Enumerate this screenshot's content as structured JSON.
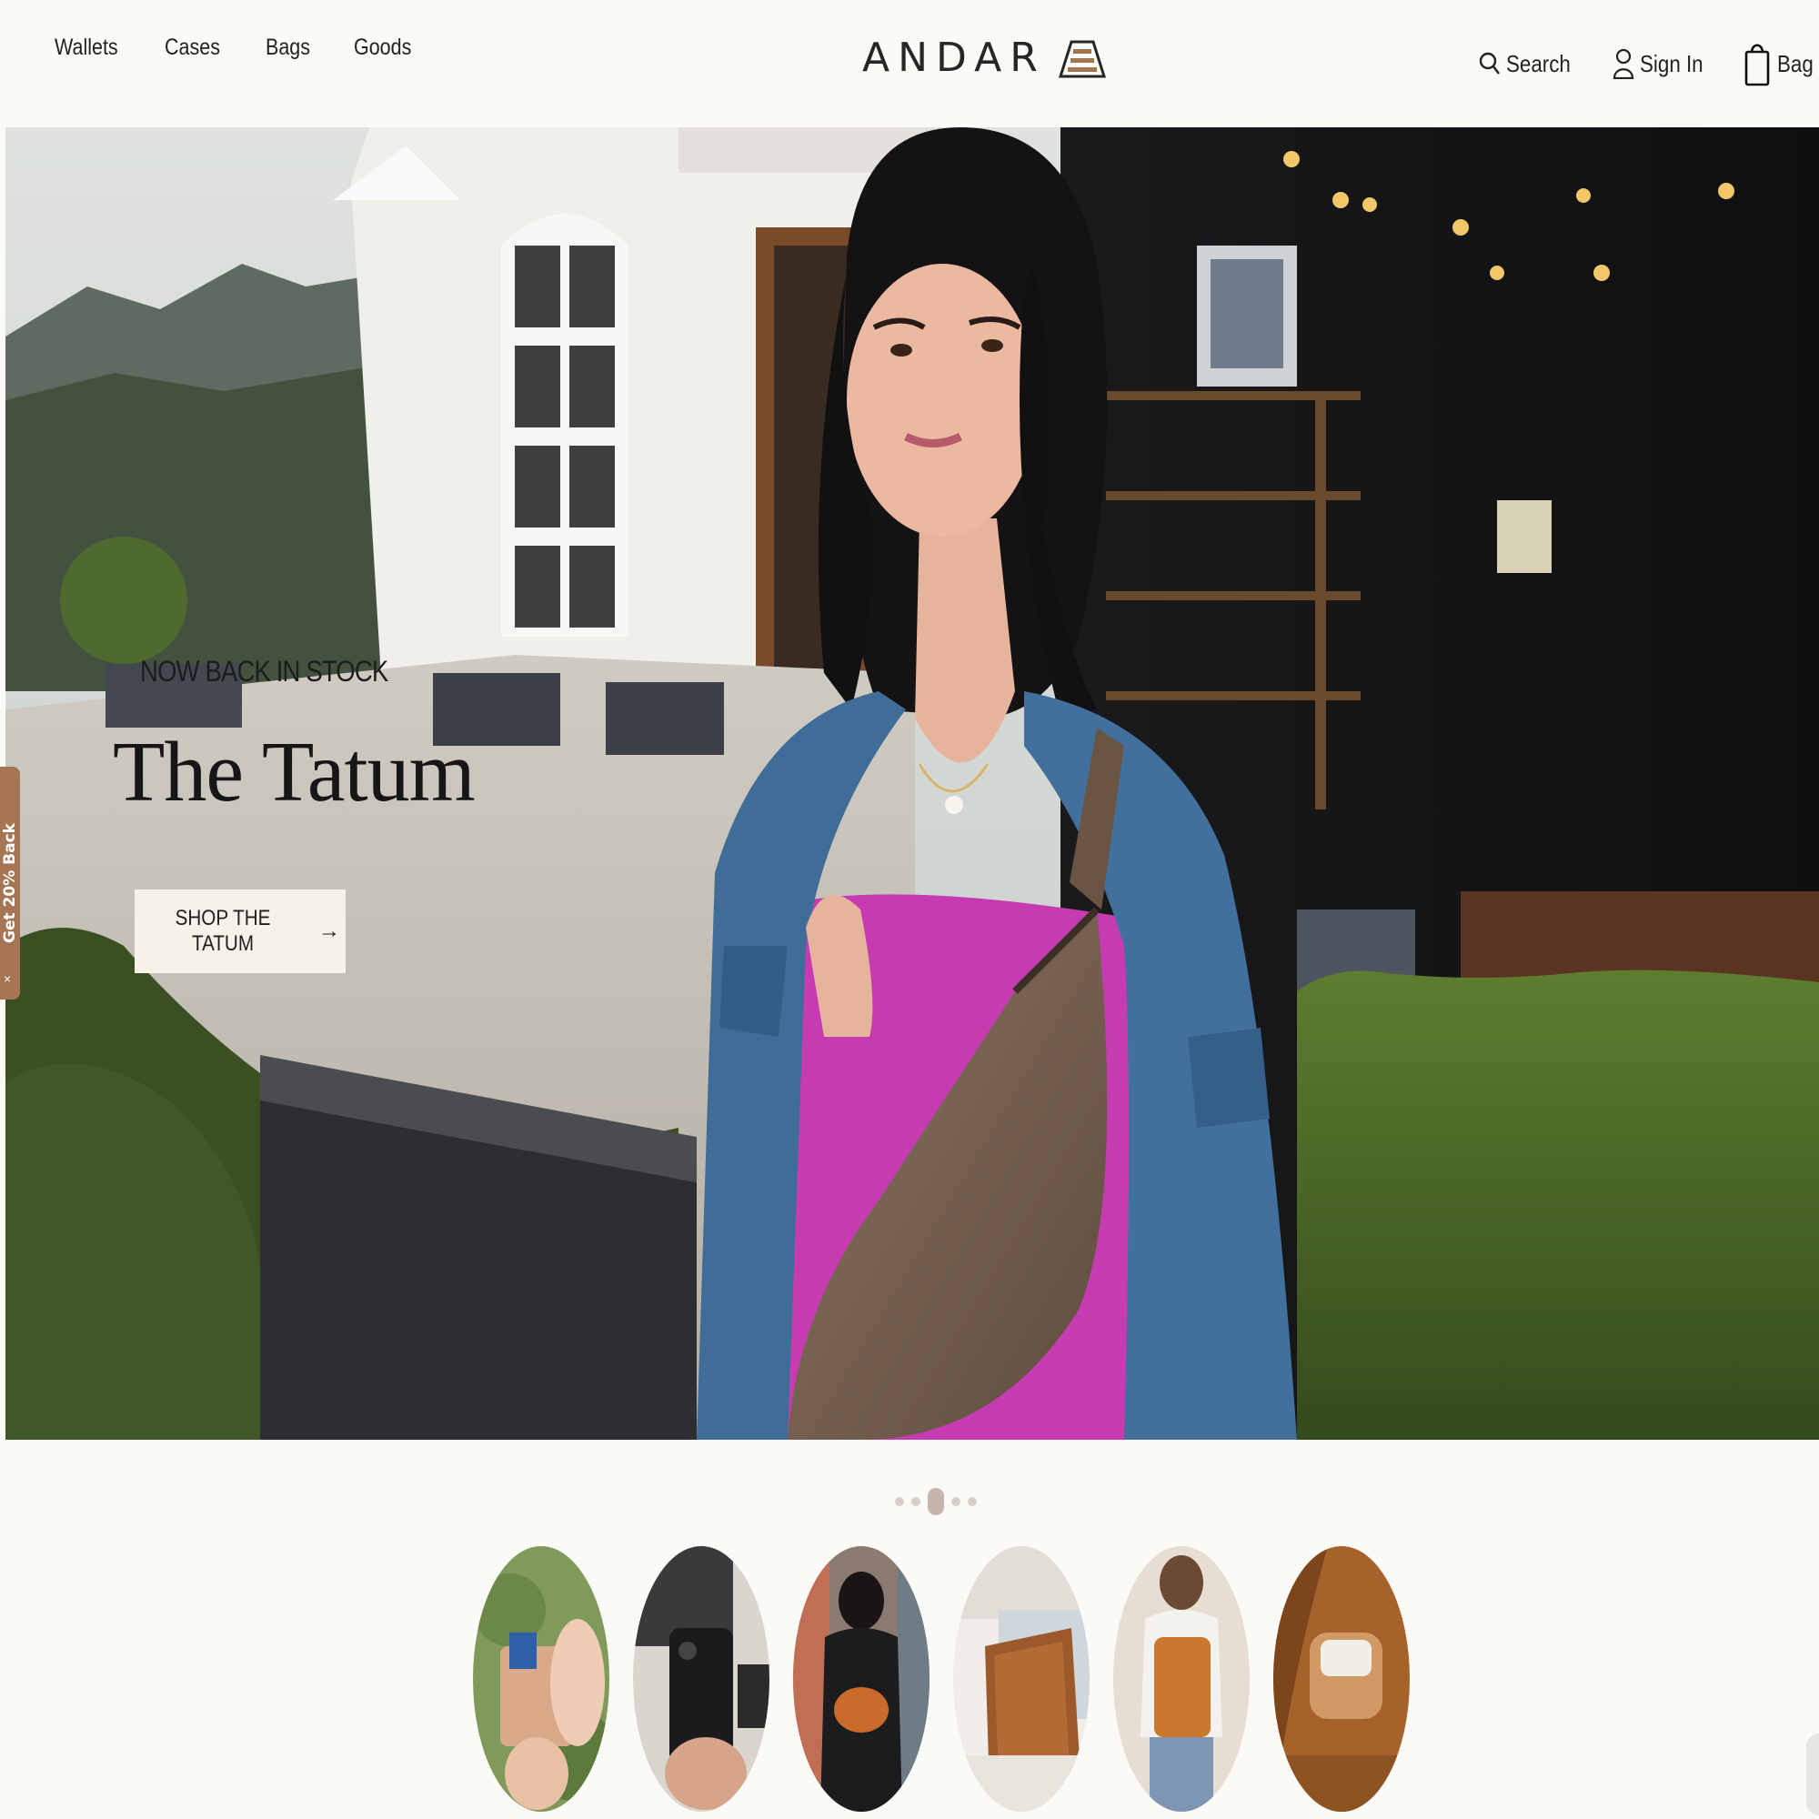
{
  "header": {
    "nav": [
      "Wallets",
      "Cases",
      "Bags",
      "Goods"
    ],
    "logo_text": "ANDAR",
    "search_label": "Search",
    "signin_label": "Sign In",
    "bag_label": "Bag"
  },
  "hero": {
    "eyebrow": "NOW BACK IN STOCK",
    "title": "The Tatum",
    "cta_label": "SHOP THE TATUM",
    "cta_arrow": "→"
  },
  "side_tab": {
    "label": "Get 20% Back",
    "close": "×",
    "color": "#a57554"
  },
  "carousel": {
    "slide_count": 5,
    "active_index": 2
  },
  "categories": [
    {
      "icon": "wallet-photo"
    },
    {
      "icon": "phone-case-photo"
    },
    {
      "icon": "sling-bag-photo"
    },
    {
      "icon": "laptop-sleeve-photo"
    },
    {
      "icon": "backpack-photo"
    },
    {
      "icon": "airpods-case-photo"
    }
  ],
  "colors": {
    "background": "#fbfaf6",
    "cta_background": "#f6f2ea",
    "leather": "#b86a2c"
  }
}
